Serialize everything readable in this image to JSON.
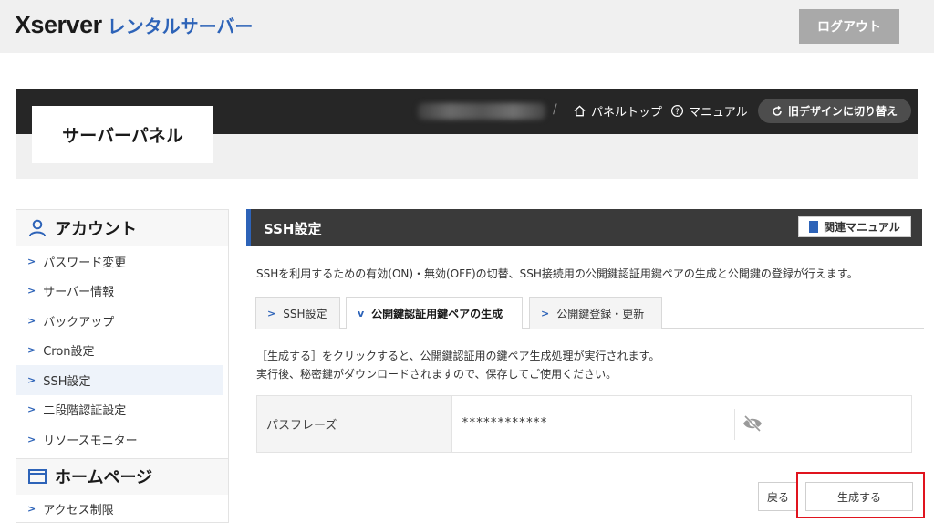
{
  "header": {
    "brand": "Xserver",
    "brand_sub": "レンタルサーバー",
    "logout_label": "ログアウト"
  },
  "panel": {
    "title": "サーバーパネル",
    "separator": "/",
    "panel_top_label": "パネルトップ",
    "manual_label": "マニュアル",
    "old_design_label": "旧デザインに切り替え"
  },
  "sidebar": {
    "account_heading": "アカウント",
    "items": [
      {
        "label": "パスワード変更"
      },
      {
        "label": "サーバー情報"
      },
      {
        "label": "バックアップ"
      },
      {
        "label": "Cron設定"
      },
      {
        "label": "SSH設定"
      },
      {
        "label": "二段階認証設定"
      },
      {
        "label": "リソースモニター"
      }
    ],
    "homepage_heading": "ホームページ",
    "homepage_items": [
      {
        "label": "アクセス制限"
      }
    ]
  },
  "content": {
    "title": "SSH設定",
    "related_manual_label": "関連マニュアル",
    "description": "SSHを利用するための有効(ON)・無効(OFF)の切替、SSH接続用の公開鍵認証用鍵ペアの生成と公開鍵の登録が行えます。",
    "tabs": [
      {
        "label": "SSH設定"
      },
      {
        "label": "公開鍵認証用鍵ペアの生成"
      },
      {
        "label": "公開鍵登録・更新"
      }
    ],
    "note_line1": "［生成する］をクリックすると、公開鍵認証用の鍵ペア生成処理が実行されます。",
    "note_line2": "実行後、秘密鍵がダウンロードされますので、保存してご使用ください。",
    "passphrase_label": "パスフレーズ",
    "passphrase_value": "************",
    "back_label": "戻る",
    "generate_label": "生成する"
  },
  "colors": {
    "accent": "#2d63b8",
    "dark_bar": "#262626",
    "highlight": "#e0141e"
  }
}
